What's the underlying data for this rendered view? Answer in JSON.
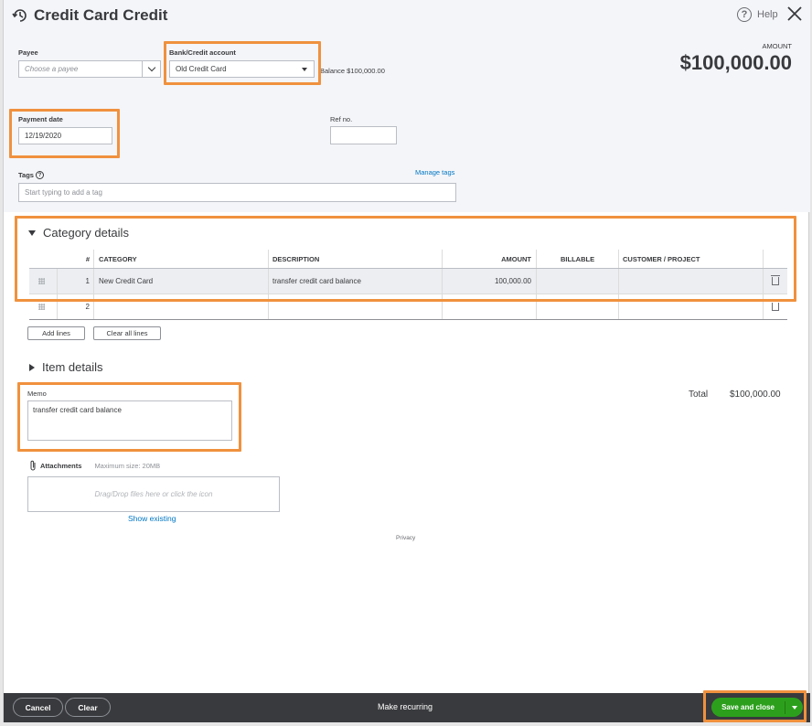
{
  "header": {
    "title": "Credit Card Credit",
    "help_label": "Help",
    "amount_label": "AMOUNT",
    "amount_value": "$100,000.00"
  },
  "form": {
    "payee_label": "Payee",
    "payee_placeholder": "Choose a payee",
    "bank_label": "Bank/Credit account",
    "bank_value": "Old Credit Card",
    "balance_text": "Balance $100,000.00",
    "payment_date_label": "Payment date",
    "payment_date_value": "12/19/2020",
    "ref_label": "Ref no.",
    "tags_label": "Tags",
    "manage_tags": "Manage tags",
    "tags_placeholder": "Start typing to add a tag"
  },
  "category": {
    "section_title": "Category details",
    "columns": {
      "num": "#",
      "category": "CATEGORY",
      "description": "DESCRIPTION",
      "amount": "AMOUNT",
      "billable": "BILLABLE",
      "customer": "CUSTOMER / PROJECT"
    },
    "rows": [
      {
        "num": "1",
        "category": "New Credit Card",
        "description": "transfer credit card balance",
        "amount": "100,000.00"
      },
      {
        "num": "2",
        "category": "",
        "description": "",
        "amount": ""
      }
    ],
    "add_lines": "Add lines",
    "clear_all_lines": "Clear all lines"
  },
  "item": {
    "section_title": "Item details"
  },
  "totals": {
    "total_label": "Total",
    "total_value": "$100,000.00"
  },
  "memo": {
    "label": "Memo",
    "value": "transfer credit card balance"
  },
  "attachments": {
    "label": "Attachments",
    "max_size": "Maximum size: 20MB",
    "drop_text": "Drag/Drop files here or click the icon",
    "show_existing": "Show existing"
  },
  "privacy": "Privacy",
  "footer": {
    "cancel": "Cancel",
    "clear": "Clear",
    "make_recurring": "Make recurring",
    "save_and_close": "Save and close"
  },
  "colors": {
    "highlight": "#f0913e",
    "save_green": "#2ca01c",
    "footer_bg": "#393a3d",
    "link": "#0077c5"
  }
}
